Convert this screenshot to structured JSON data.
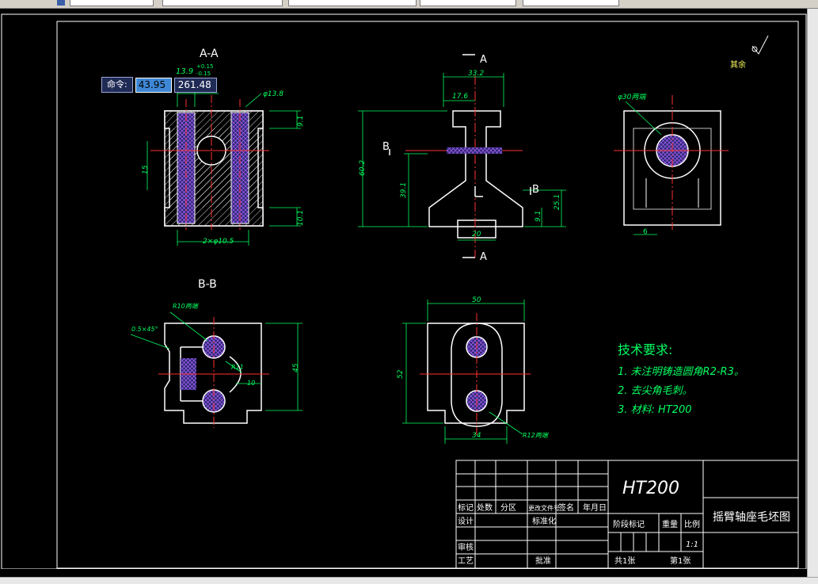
{
  "command_tooltip": {
    "label": "命令:",
    "value_x": "43.95",
    "value_y": "261.48"
  },
  "drawing": {
    "section_aa_title": "A-A",
    "section_bb_title": "B-B",
    "roughness_text": "其余",
    "section_marker_a": "A",
    "section_marker_b": "B",
    "dims": {
      "d13_9": "13.9",
      "tol_p": "+0.15",
      "tol_m": "-0.15",
      "phi13_8": "φ13.8",
      "d9_1a": "9.1",
      "d15": "15",
      "d10_1": "10.1",
      "d2phi10_5": "2×φ10.5",
      "d33_2": "33.2",
      "d17_6": "17.6",
      "d60_2": "60.2",
      "d39_1": "39.1",
      "d25_1": "25.1",
      "d9_1b": "9.1",
      "d20": "20",
      "phi30": "φ30两端",
      "d6": "6",
      "r10": "R10两端",
      "chamfer": "0.5×45°",
      "r11": "R11",
      "d10": "10",
      "d45": "45",
      "d50": "50",
      "d52": "52",
      "d34": "34",
      "r12": "R12两端"
    },
    "tech_req": {
      "title": "技术要求:",
      "item1": "1. 未注明铸造圆角R2-R3。",
      "item2": "2. 去尖角毛刺。",
      "item3": "3. 材料: HT200"
    },
    "title_block": {
      "material": "HT200",
      "drawing_name": "摇臂轴座毛坯图",
      "h_mark": "标记",
      "h_count": "处数",
      "h_zone": "分区",
      "h_docno": "更改文件号",
      "h_sign": "签名",
      "h_date": "年月日",
      "design": "设计",
      "standardize": "标准化",
      "stage_mark": "阶段标记",
      "weight": "重量",
      "scale": "比例",
      "scale_value": "1:1",
      "review": "审核",
      "process": "工艺",
      "approve": "批准",
      "total_sheets": "共1张",
      "sheet_no": "第1张"
    }
  }
}
